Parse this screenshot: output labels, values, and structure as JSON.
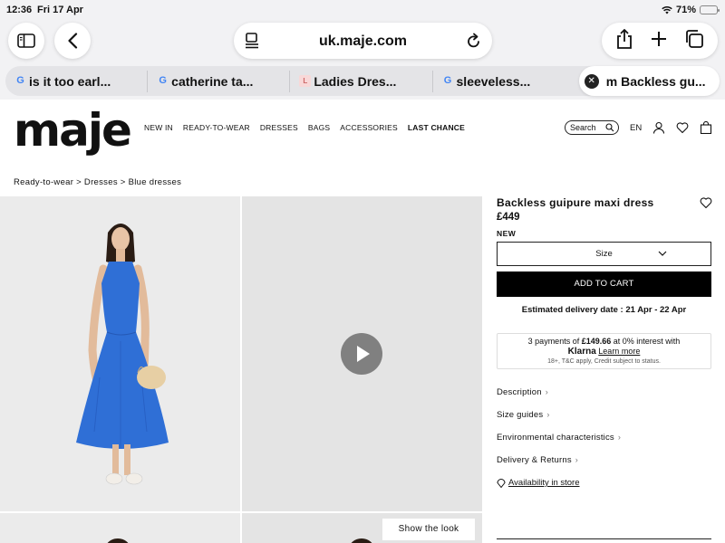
{
  "status_bar": {
    "time": "12:36",
    "date": "Fri 17 Apr",
    "battery": "71%",
    "battery_level": 0.71
  },
  "browser": {
    "url": "uk.maje.com",
    "tabs": [
      {
        "label": "is it too earl...",
        "favicon": "google-g"
      },
      {
        "label": "catherine ta...",
        "favicon": "google-g"
      },
      {
        "label": "Ladies Dres...",
        "favicon": "site-favicon"
      },
      {
        "label": "sleeveless...",
        "favicon": "google-g"
      },
      {
        "label": "Backless gu...",
        "favicon": "maje-m",
        "active": true
      }
    ],
    "tab_favicon_letters": {
      "google": "G",
      "site": "L",
      "maje": "m"
    }
  },
  "site": {
    "logo": "maje",
    "nav": [
      "NEW IN",
      "READY-TO-WEAR",
      "DRESSES",
      "BAGS",
      "ACCESSORIES",
      "LAST CHANCE"
    ],
    "search_label": "Search",
    "language": "EN"
  },
  "breadcrumb": "Ready-to-wear > Dresses > Blue dresses",
  "product": {
    "title": "Backless guipure maxi dress",
    "price": "£449",
    "badge": "NEW",
    "size_label": "Size",
    "add_to_cart": "ADD TO CART",
    "delivery_estimate": "Estimated delivery date : 21 Apr - 22 Apr",
    "klarna": {
      "line1_prefix": "3 payments of",
      "line1_amount": "£149.66",
      "line1_suffix": "at 0% interest with",
      "brand": "Klarna",
      "learn_more": "Learn more",
      "disclaimer": "18+, T&C apply, Credit subject to status."
    },
    "sections": [
      "Description",
      "Size guides",
      "Environmental characteristics",
      "Delivery & Returns"
    ],
    "availability": "Availability in store",
    "show_the_look": "Show the look"
  },
  "colors": {
    "dress_blue": "#2f6fd6",
    "cart_button": "#000000",
    "battery_yellow": "#f3c21c"
  }
}
